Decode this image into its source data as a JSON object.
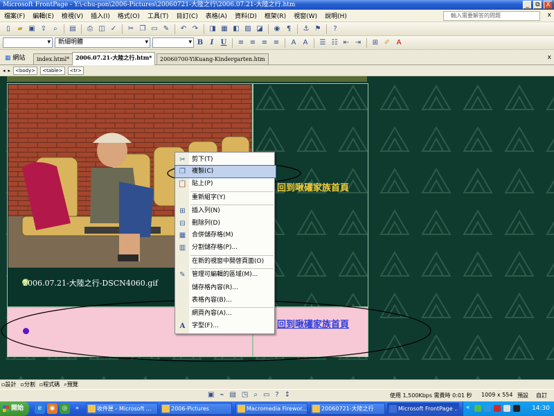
{
  "window": {
    "title": "Microsoft FrontPage - Y:\\-chu-pon\\2006-Pictures\\20060721-大陸之行\\2006.07.21-大陸之行.htm",
    "controls": [
      "_",
      "⧉",
      "X"
    ]
  },
  "menubar": {
    "items": [
      "檔案(F)",
      "編輯(E)",
      "檢視(V)",
      "插入(I)",
      "格式(O)",
      "工具(T)",
      "目訂(C)",
      "表格(A)",
      "資料(D)",
      "框架(R)",
      "視窗(W)",
      "說明(H)"
    ],
    "help_placeholder": "輸入需要解答的問題",
    "close_label": "x"
  },
  "format_toolbar": {
    "style_value": "",
    "font_value": "新細明體",
    "size_value": "",
    "bold": "B",
    "italic": "I",
    "underline": "U"
  },
  "doc_tabs": {
    "site_label": "網站",
    "tabs": [
      {
        "label": "index.html*",
        "active": false
      },
      {
        "label": "2006.07.21-大陸之行.htm*",
        "active": true
      },
      {
        "label": "20060700-YiKuang-Kindergarten.htm",
        "active": false
      }
    ],
    "close_label": "x"
  },
  "tag_bar": [
    "<body>",
    "<table>",
    "<tr>"
  ],
  "page": {
    "caption": "2006.07.21-大陸之行-DSCN4060.gif",
    "home_link_top": "回到啾礶家族首頁",
    "home_link_bottom": "回到啾礶家族首頁"
  },
  "context_menu": {
    "items": [
      {
        "label": "剪下(T)",
        "icon": "scissors-icon",
        "glyph": "✂"
      },
      {
        "label": "複製(C)",
        "icon": "copy-icon",
        "glyph": "❐",
        "hot": true
      },
      {
        "label": "貼上(P)",
        "icon": "paste-icon",
        "glyph": "📋"
      },
      {
        "label": "重新組字(Y)",
        "icon": "",
        "glyph": ""
      },
      {
        "label": "插入列(N)",
        "icon": "insert-row-icon",
        "glyph": "⊞"
      },
      {
        "label": "刪除列(D)",
        "icon": "delete-row-icon",
        "glyph": "⊟"
      },
      {
        "label": "合併儲存格(M)",
        "icon": "merge-cells-icon",
        "glyph": "▦"
      },
      {
        "label": "分割儲存格(P)...",
        "icon": "split-cells-icon",
        "glyph": "▥"
      },
      {
        "label": "在新的視窗中開啓頁面(O)",
        "icon": "",
        "glyph": ""
      },
      {
        "label": "管理可編輯的區域(M)...",
        "icon": "editable-region-icon",
        "glyph": "✎"
      },
      {
        "label": "儲存格內容(R)...",
        "icon": "",
        "glyph": ""
      },
      {
        "label": "表格內容(B)...",
        "icon": "",
        "glyph": ""
      },
      {
        "label": "網頁內容(A)...",
        "icon": "",
        "glyph": ""
      },
      {
        "label": "字型(F)...",
        "icon": "font-icon",
        "glyph": "A"
      }
    ]
  },
  "view_tabs": [
    "設計",
    "分割",
    "程式碼",
    "預覽"
  ],
  "status_bar": {
    "speed": "使用 1,500Kbps 需費時 0:01 秒",
    "size": "1009 x 554",
    "mode1": "預設",
    "mode2": "自訂"
  },
  "taskbar": {
    "start": "開始",
    "tasks": [
      {
        "label": "收件匣 - Microsoft ...",
        "active": false
      },
      {
        "label": "2006-Pictures",
        "active": false
      },
      {
        "label": "Macromedia Firewor...",
        "active": false
      },
      {
        "label": "20060721-大陸之行",
        "active": false
      },
      {
        "label": "Microsoft FrontPage ...",
        "active": true
      }
    ],
    "clock": "14:30"
  },
  "colors": {
    "canvas_bg": "#0F3A2E",
    "pink_row": "#F7C8D6",
    "gold_link": "#F2CE3A",
    "blue_link": "#2B3EE0"
  }
}
